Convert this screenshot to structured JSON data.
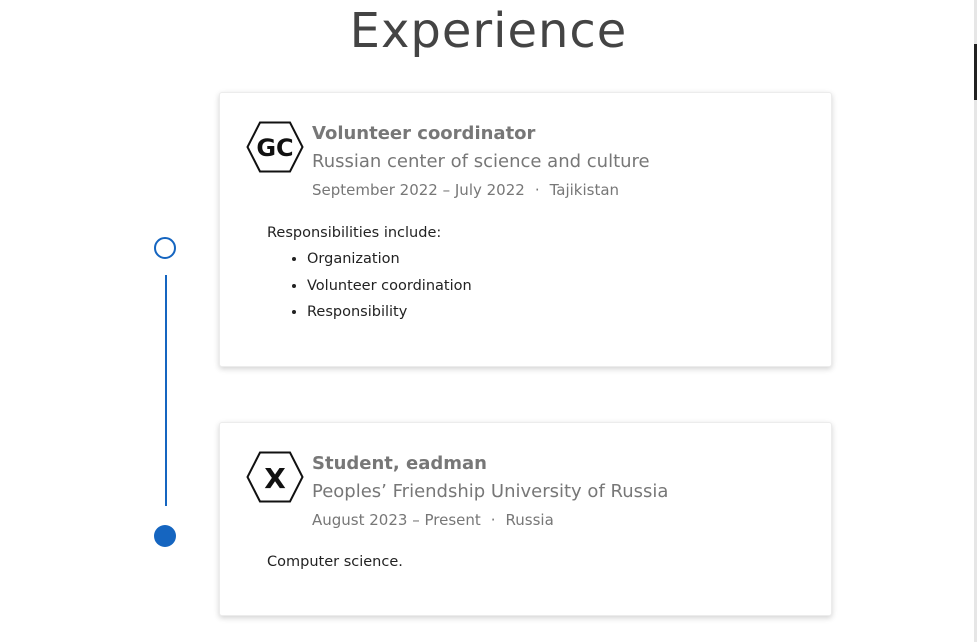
{
  "section": {
    "title": "Experience"
  },
  "experience": [
    {
      "role": "Volunteer coordinator",
      "organization": "Russian center of science and culture",
      "dates": "September 2022 – July 2022",
      "separator": "·",
      "location": "Tajikistan",
      "logo_text": "GC",
      "description": "Responsibilities include:",
      "items": [
        "Organization",
        "Volunteer coordination",
        "Responsibility"
      ]
    },
    {
      "role": "Student, eadman",
      "organization": "Peoples’ Friendship University of Russia",
      "dates": "August 2023 – Present",
      "separator": "·",
      "location": "Russia",
      "logo_text": "X",
      "description": "Computer science."
    }
  ],
  "colors": {
    "accent": "#1565c0",
    "muted_text": "#777777",
    "body_text": "#222222"
  }
}
